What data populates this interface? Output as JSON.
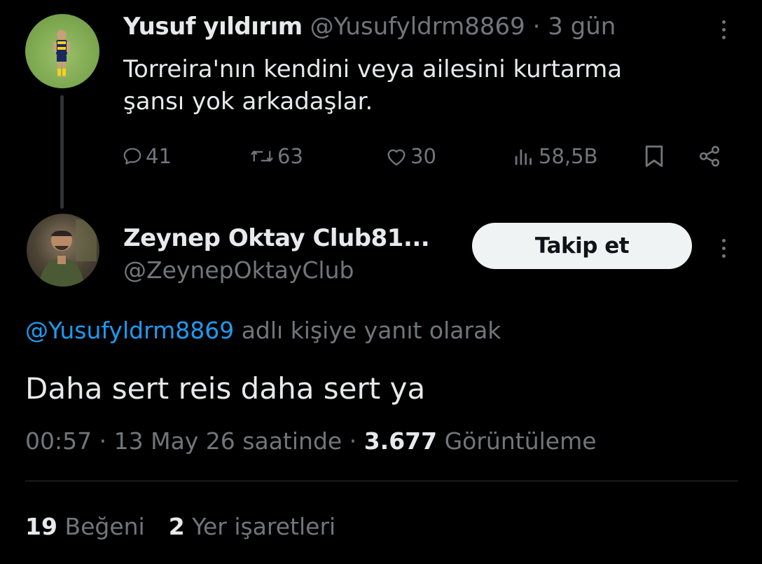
{
  "parent_tweet": {
    "author_name": "Yusuf yıldırım",
    "handle": "@Yusufyldrm8869",
    "separator": "·",
    "time_ago": "3 gün",
    "text_line1": "Torreira'nın kendini veya ailesini kurtarma",
    "text_line2": "şansı yok arkadaşlar.",
    "metrics": {
      "replies": "41",
      "retweets": "63",
      "likes": "30",
      "views": "58,5B"
    }
  },
  "reply_tweet": {
    "author_name": "Zeynep Oktay Club81...",
    "handle": "@ZeynepOktayClub",
    "follow_label": "Takip et",
    "replying_to_handle": "@Yusufyldrm8869",
    "replying_to_suffix": "adlı kişiye yanıt olarak",
    "text": "Daha sert reis daha sert ya",
    "time": "00:57",
    "separator": "·",
    "date_text": "13 May 26 saatinde",
    "views_count": "3.677",
    "views_label": "Görüntüleme",
    "likes_count": "19",
    "likes_label": "Beğeni",
    "bookmarks_count": "2",
    "bookmarks_label": "Yer işaretleri"
  },
  "icons": {
    "reply": "reply-icon",
    "retweet": "retweet-icon",
    "like": "heart-icon",
    "views": "views-icon",
    "bookmark": "bookmark-icon",
    "share": "share-icon",
    "more": "more-options-icon"
  },
  "colors": {
    "background": "#000000",
    "text": "#e7e9ea",
    "muted": "#71767b",
    "link": "#1d9bf0",
    "button_bg": "#eff3f4",
    "divider": "#2f3336"
  }
}
